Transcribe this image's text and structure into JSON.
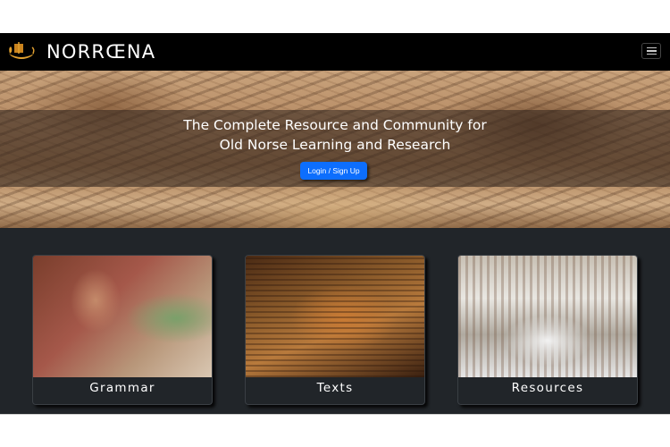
{
  "navbar": {
    "brand": "NORRŒNA",
    "logo_icon": "viking-ship-icon",
    "menu_icon": "hamburger-icon"
  },
  "hero": {
    "title_line1": "The Complete Resource and Community for",
    "title_line2": "Old Norse Learning and Research",
    "login_label": "Login / Sign Up"
  },
  "cards": [
    {
      "label": "Grammar",
      "image": "scholar-painting"
    },
    {
      "label": "Texts",
      "image": "manuscript-photo"
    },
    {
      "label": "Resources",
      "image": "library-interior-photo"
    }
  ],
  "colors": {
    "navbar_bg": "#000000",
    "cards_bg": "#212529",
    "primary_button": "#0d6efd",
    "logo_gold": "#e0a030"
  }
}
